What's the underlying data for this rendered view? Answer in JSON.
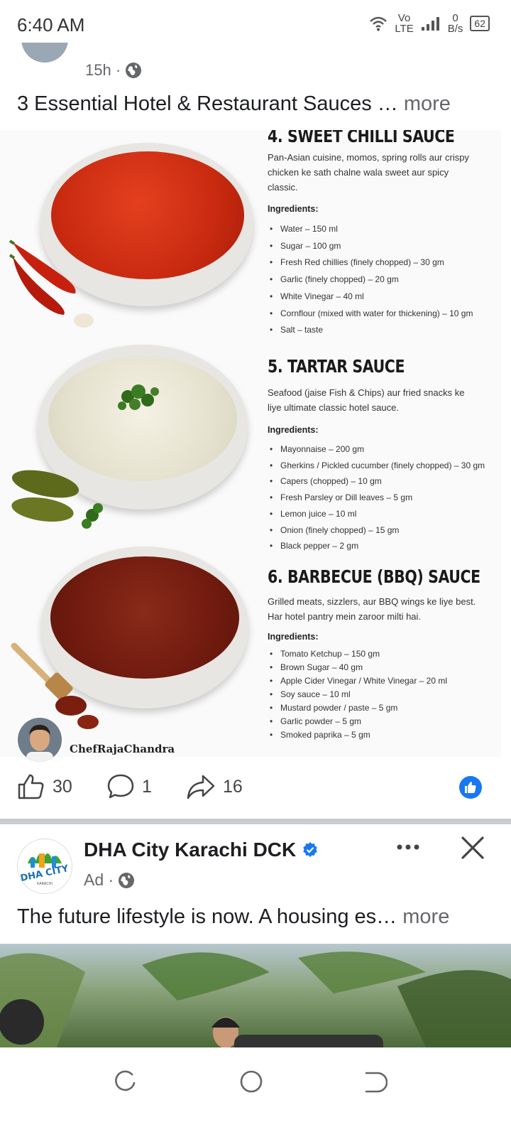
{
  "status_bar": {
    "time": "6:40 AM",
    "network_top": "Vo",
    "network_bottom": "LTE",
    "speed_value": "0",
    "speed_unit": "B/s",
    "battery": "62"
  },
  "post": {
    "time_ago": "15h ·",
    "caption": "3 Essential Hotel & Restaurant Sauces …",
    "caption_more": "more",
    "image": {
      "sections": [
        {
          "title": "4. SWEET CHILLI SAUCE",
          "description": "Pan-Asian cuisine, momos, spring rolls aur crispy chicken ke sath chalne wala sweet aur spicy classic.",
          "ingredients_label": "Ingredients:",
          "ingredients": [
            "Water – 150 ml",
            "Sugar – 100 gm",
            "Fresh Red chillies (finely chopped) – 30 gm",
            "Garlic (finely chopped) – 20 gm",
            "White Vinegar – 40 ml",
            "Cornflour (mixed with water for thickening) – 10 gm",
            "Salt – taste"
          ]
        },
        {
          "title": "5. TARTAR SAUCE",
          "description": "Seafood (jaise Fish & Chips) aur fried snacks ke liye ultimate classic hotel sauce.",
          "ingredients_label": "Ingredients:",
          "ingredients": [
            "Mayonnaise – 200 gm",
            "Gherkins / Pickled cucumber (finely chopped) – 30 gm",
            "Capers (chopped) – 10 gm",
            "Fresh Parsley or Dill leaves – 5 gm",
            "Lemon juice – 10 ml",
            "Onion (finely chopped) – 15 gm",
            "Black pepper – 2 gm"
          ]
        },
        {
          "title": "6. BARBECUE (BBQ) SAUCE",
          "description": "Grilled meats, sizzlers, aur BBQ wings ke liye best. Har hotel pantry mein zaroor milti hai.",
          "ingredients_label": "Ingredients:",
          "ingredients": [
            "Tomato Ketchup – 150 gm",
            "Brown Sugar – 40 gm",
            "Apple Cider Vinegar / White Vinegar – 20 ml",
            "Soy sauce – 10 ml",
            "Mustard powder / paste – 5 gm",
            "Garlic powder – 5 gm",
            "Smoked paprika – 5 gm"
          ]
        }
      ],
      "watermark": "ChefRajaChandra"
    },
    "reactions": {
      "likes": "30",
      "comments": "1",
      "shares": "16"
    }
  },
  "ad": {
    "page_name": "DHA City Karachi DCK",
    "logo_text": "DHA CITY",
    "logo_subtext": "KARACHI",
    "label": "Ad ·",
    "text": "The future lifestyle is now. A housing es…",
    "text_more": "more"
  },
  "colors": {
    "fb_blue": "#1877f2",
    "meta_gray": "#65676b",
    "divider": "#c9ccd1"
  }
}
